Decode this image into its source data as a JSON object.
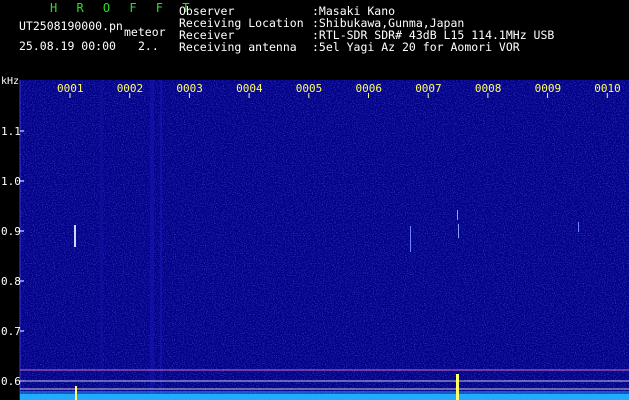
{
  "header": {
    "brand": "H R O F F T",
    "filename": "UT2508190000.pn",
    "meteor_label": "meteor",
    "datetime": "25.08.19 00:00",
    "page_indicator": "2..",
    "info": [
      {
        "label": "Observer",
        "value": ":Masaki Kano"
      },
      {
        "label": "Receiving Location",
        "value": ":Shibukawa,Gunma,Japan"
      },
      {
        "label": "Receiver",
        "value": ":RTL-SDR SDR# 43dB L15 114.1MHz USB"
      },
      {
        "label": "Receiving antenna",
        "value": ":5el Yagi Az 20 for Aomori VOR"
      }
    ]
  },
  "spectrogram": {
    "freq_unit": "kHz",
    "freq_ticks": [
      {
        "value": 1.1,
        "label": "1.1"
      },
      {
        "value": 1.0,
        "label": "1.0"
      },
      {
        "value": 0.9,
        "label": "0.9"
      },
      {
        "value": 0.8,
        "label": "0.8"
      },
      {
        "value": 0.7,
        "label": "0.7"
      },
      {
        "value": 0.6,
        "label": "0.6"
      }
    ],
    "time_ticks": [
      "0001",
      "0002",
      "0003",
      "0004",
      "0005",
      "0006",
      "0007",
      "0008",
      "0009",
      "0010"
    ],
    "colors": {
      "background": "#000088",
      "noise": "#1a1aa8",
      "ticks": "#ffff66",
      "signal": "#ffffff",
      "baseline": "#22aaff"
    }
  }
}
